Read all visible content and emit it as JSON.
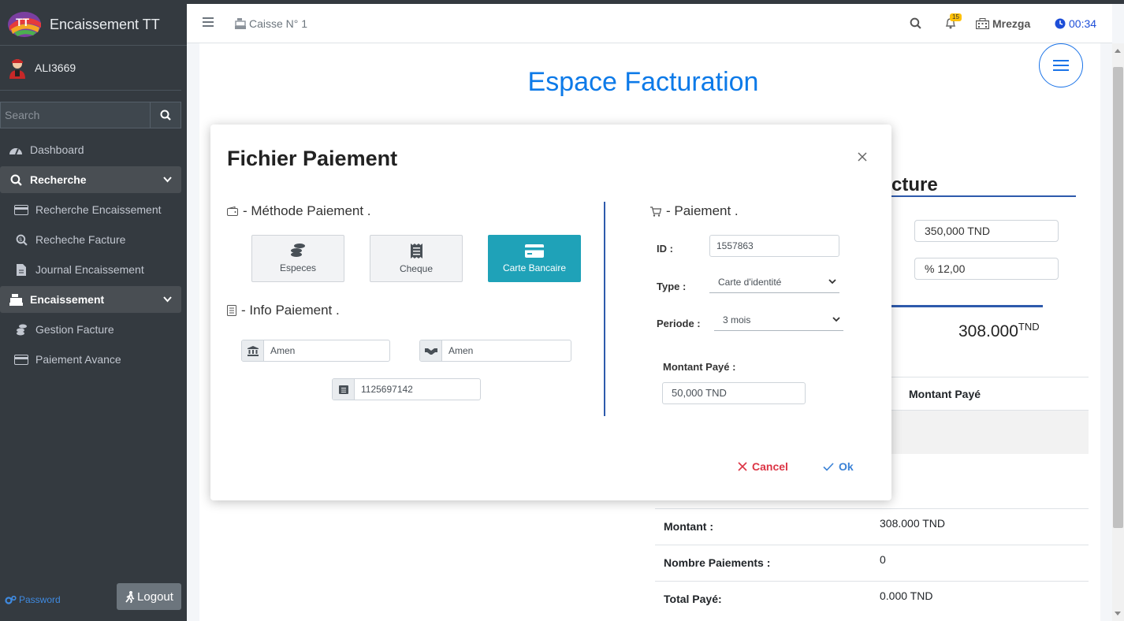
{
  "app": {
    "title": "Encaissement TT",
    "username": "ALI3669"
  },
  "sidebar": {
    "search_placeholder": "Search",
    "items": [
      {
        "label": "Dashboard"
      },
      {
        "label": "Recherche"
      },
      {
        "label": "Recherche Encaissement"
      },
      {
        "label": "Recheche Facture"
      },
      {
        "label": "Journal Encaissement"
      },
      {
        "label": "Encaissement"
      },
      {
        "label": "Gestion Facture"
      },
      {
        "label": "Paiement Avance"
      }
    ],
    "password_label": "Password",
    "logout_label": "Logout"
  },
  "navbar": {
    "caisse": "Caisse N° 1",
    "notif_count": "15",
    "site": "Mrezga",
    "time": "00:34"
  },
  "page": {
    "title": "Espace Facturation",
    "heading_partial": "cture",
    "amount_input": "350,000 TND",
    "percent_input": "% 12,00",
    "total": "308.000",
    "total_unit": "TND",
    "table_header": "Montant Payé",
    "summary": [
      {
        "key": "Montant :",
        "value": "308.000 TND"
      },
      {
        "key": "Nombre Paiements :",
        "value": "0"
      },
      {
        "key": "Total Payé:",
        "value": "0.000 TND"
      }
    ]
  },
  "modal": {
    "title": "Fichier Paiement",
    "methode_title": "- Méthode Paiement .",
    "methods": [
      {
        "label": "Especes"
      },
      {
        "label": "Cheque"
      },
      {
        "label": "Carte Bancaire"
      }
    ],
    "selected_method": "Carte Bancaire",
    "info_title": "- Info Paiement .",
    "bank": "Amen",
    "agency": "Amen",
    "account": "1125697142",
    "paiement_title": "- Paiement .",
    "id_label": "ID :",
    "id_value": "1557863",
    "type_label": "Type :",
    "type_value": "Carte d'identité",
    "periode_label": "Periode :",
    "periode_value": "3 mois",
    "montant_label": "Montant Payé :",
    "montant_value": "50,000 TND",
    "cancel_label": "Cancel",
    "ok_label": "Ok"
  },
  "colors": {
    "accent": "#0d7ae8",
    "sidebar": "#343a40",
    "active_method": "#1fa2b8",
    "cancel": "#dc3545",
    "ok": "#3b82d6"
  }
}
